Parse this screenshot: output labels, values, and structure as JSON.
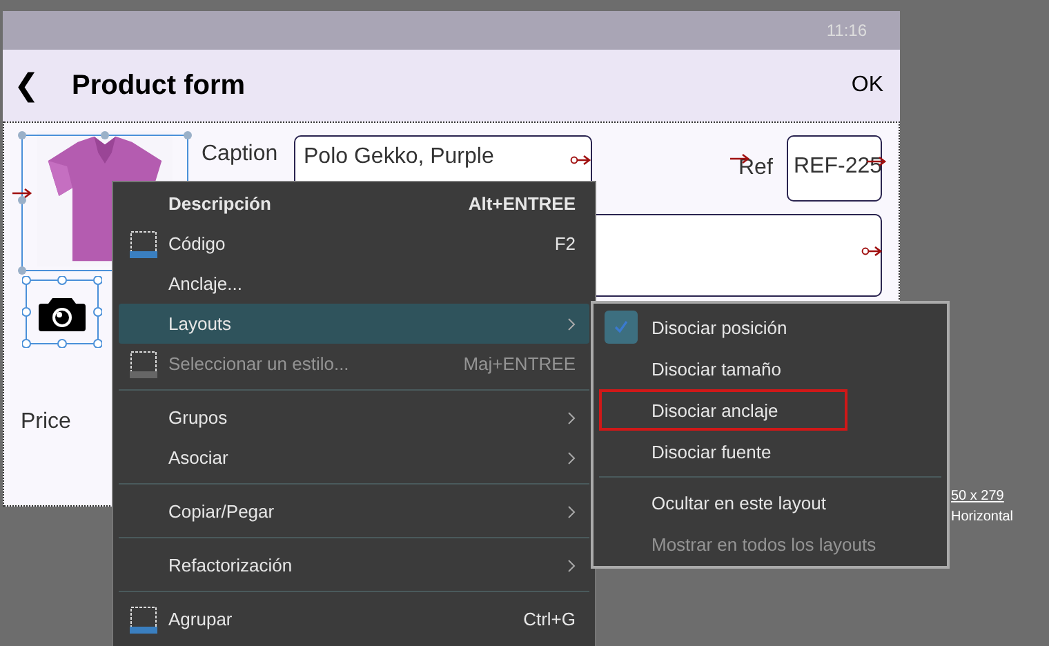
{
  "status_bar": {
    "time": "11:16"
  },
  "header": {
    "back": "❮",
    "title": "Product form",
    "action": "OK"
  },
  "form": {
    "caption_label": "Caption",
    "caption_value": "Polo Gekko, Purple",
    "ref_label": "Ref",
    "ref_value": "REF-225",
    "price_label": "Price"
  },
  "size_info": {
    "dimensions": "50 x 279",
    "orientation": "Horizontal"
  },
  "context_menu": {
    "items": [
      {
        "kind": "item",
        "label": "Descripción",
        "shortcut": "Alt+ENTREE",
        "bold": true,
        "icon": false,
        "submenu": false,
        "disabled": false,
        "selected": false
      },
      {
        "kind": "item",
        "label": "Código",
        "shortcut": "F2",
        "bold": false,
        "icon": true,
        "submenu": false,
        "disabled": false,
        "selected": false
      },
      {
        "kind": "item",
        "label": "Anclaje...",
        "bold": false,
        "icon": false,
        "submenu": false,
        "disabled": false,
        "selected": false
      },
      {
        "kind": "item",
        "label": "Layouts",
        "bold": false,
        "icon": false,
        "submenu": true,
        "disabled": false,
        "selected": true
      },
      {
        "kind": "item",
        "label": "Seleccionar un estilo...",
        "shortcut": "Maj+ENTREE",
        "bold": false,
        "icon": true,
        "submenu": false,
        "disabled": true,
        "selected": false
      },
      {
        "kind": "separator"
      },
      {
        "kind": "item",
        "label": "Grupos",
        "bold": false,
        "icon": false,
        "submenu": true,
        "disabled": false,
        "selected": false
      },
      {
        "kind": "item",
        "label": "Asociar",
        "bold": false,
        "icon": false,
        "submenu": true,
        "disabled": false,
        "selected": false
      },
      {
        "kind": "separator"
      },
      {
        "kind": "item",
        "label": "Copiar/Pegar",
        "bold": false,
        "icon": false,
        "submenu": true,
        "disabled": false,
        "selected": false
      },
      {
        "kind": "separator"
      },
      {
        "kind": "item",
        "label": "Refactorización",
        "bold": false,
        "icon": false,
        "submenu": true,
        "disabled": false,
        "selected": false
      },
      {
        "kind": "separator"
      },
      {
        "kind": "item",
        "label": "Agrupar",
        "shortcut": "Ctrl+G",
        "bold": false,
        "icon": true,
        "submenu": false,
        "disabled": false,
        "selected": false
      }
    ]
  },
  "submenu": {
    "items": [
      {
        "kind": "item",
        "label": "Disociar posición",
        "checked": true,
        "disabled": false,
        "outlined": false
      },
      {
        "kind": "item",
        "label": "Disociar tamaño",
        "checked": false,
        "disabled": false,
        "outlined": false
      },
      {
        "kind": "item",
        "label": "Disociar anclaje",
        "checked": false,
        "disabled": false,
        "outlined": true
      },
      {
        "kind": "item",
        "label": "Disociar fuente",
        "checked": false,
        "disabled": false,
        "outlined": false
      },
      {
        "kind": "separator"
      },
      {
        "kind": "item",
        "label": "Ocultar en este layout",
        "checked": false,
        "disabled": false,
        "outlined": false
      },
      {
        "kind": "item",
        "label": "Mostrar en todos los layouts",
        "checked": false,
        "disabled": true,
        "outlined": false
      }
    ]
  }
}
